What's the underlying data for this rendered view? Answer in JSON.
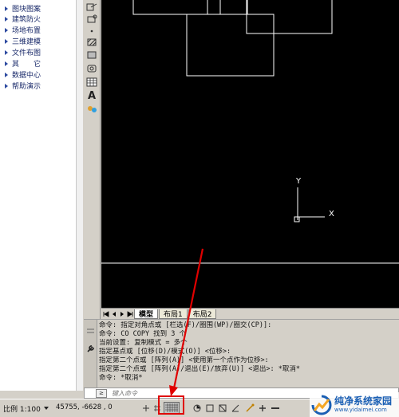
{
  "menu": {
    "items": [
      "图块图案",
      "建筑防火",
      "场地布置",
      "三维建模",
      "文件布图",
      "其　　它",
      "数据中心",
      "帮助演示"
    ]
  },
  "toolbar": {
    "text_tool": "A"
  },
  "canvas": {
    "ucs_x": "X",
    "ucs_y": "Y"
  },
  "tabs": [
    {
      "label": "模型",
      "active": true
    },
    {
      "label": "布局1",
      "active": false
    },
    {
      "label": "布局2",
      "active": false
    }
  ],
  "command": {
    "history": [
      "命令: 指定对角点或 [栏选(F)/圈围(WP)/圈交(CP)]:",
      "命令: CO COPY 找到 3 个",
      "当前设置:  复制模式 = 多个",
      "指定基点或 [位移(D)/模式(O)] <位移>:",
      "指定第二个点或 [阵列(A)] <使用第一个点作为位移>:",
      "指定第二个点或 [阵列(A)/退出(E)/放弃(U)] <退出>: *取消*",
      "命令: *取消*"
    ],
    "input_placeholder": "键入命令",
    "prompt_icon": "≥"
  },
  "status": {
    "scale": "比例 1:100",
    "coordinates": "45755, -6628 , 0"
  },
  "colors": {
    "annotation": "#e00000",
    "canvas_bg": "#000000",
    "drawing_lines": "#ffffff"
  },
  "watermark": {
    "title": "纯净系统家园",
    "url": "www.yidaimei.com"
  }
}
